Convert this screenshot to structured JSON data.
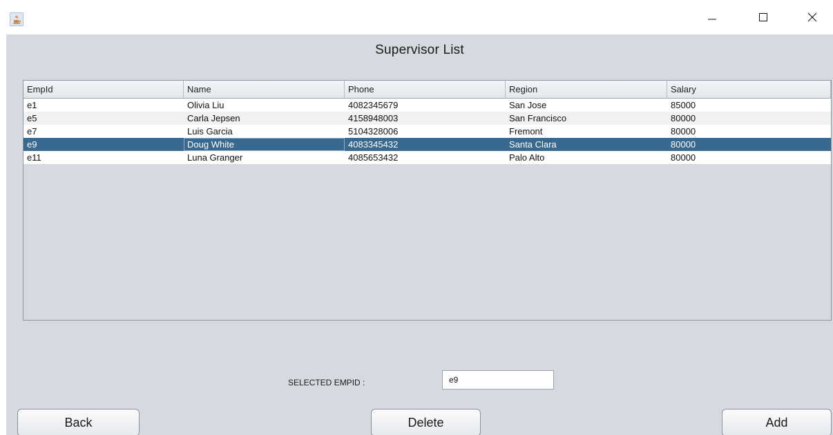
{
  "window": {
    "app_icon": "java-coffee-icon",
    "controls": [
      "minimize-icon",
      "maximize-icon",
      "close-icon"
    ]
  },
  "page": {
    "title": "Supervisor List"
  },
  "table": {
    "columns": [
      "EmpId",
      "Name",
      "Phone",
      "Region",
      "Salary"
    ],
    "rows": [
      [
        "e1",
        "Olivia Liu",
        "4082345679",
        "San Jose",
        "85000"
      ],
      [
        "e5",
        "Carla Jepsen",
        "4158948003",
        "San Francisco",
        "80000"
      ],
      [
        "e7",
        "Luis Garcia",
        "5104328006",
        "Fremont",
        "80000"
      ],
      [
        "e9",
        "Doug White",
        "4083345432",
        "Santa Clara",
        "80000"
      ],
      [
        "e11",
        "Luna Granger",
        "4085653432",
        "Palo Alto",
        "80000"
      ]
    ],
    "selected_row": 3,
    "selected_color": "#39698f"
  },
  "selection": {
    "label": "SELECTED EMPID :",
    "value": "e9"
  },
  "buttons": {
    "back": "Back",
    "delete": "Delete",
    "add": "Add"
  }
}
